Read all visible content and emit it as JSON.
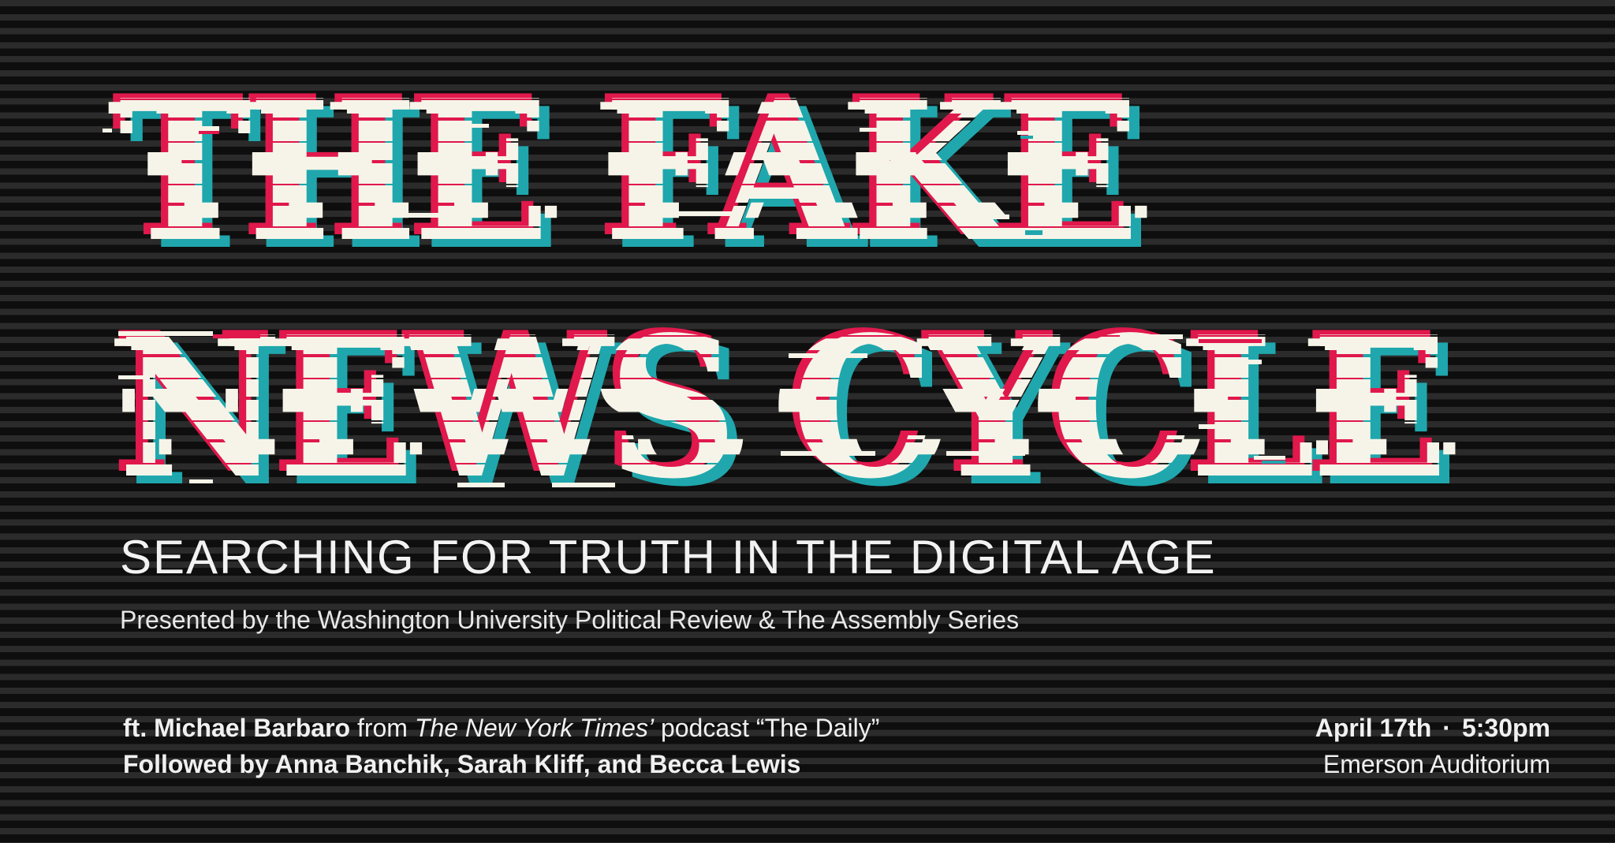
{
  "headline": {
    "line1": "THE FAKE",
    "line2": "NEWS CYCLE"
  },
  "subtitle": "SEARCHING FOR TRUTH IN THE DIGITAL AGE",
  "presenter": "Presented by the Washington University Political Review & The Assembly Series",
  "feature": {
    "prefix": "ft. Michael Barbaro",
    "from": " from ",
    "publication": "The New York Times’",
    "podcast": " podcast “The Daily”",
    "followed": "Followed by Anna Banchik, Sarah Kliff, and Becca Lewis"
  },
  "event": {
    "date": "April 17th",
    "separator": "·",
    "time": "5:30pm",
    "venue": "Emerson Auditorium"
  },
  "colors": {
    "background": "#111111",
    "stripe": "#2b2b2b",
    "headline_text": "#f6f4e8",
    "glitch_red": "#e0184c",
    "glitch_cyan": "#1fa7ad",
    "body_text": "#f0f0f0"
  }
}
